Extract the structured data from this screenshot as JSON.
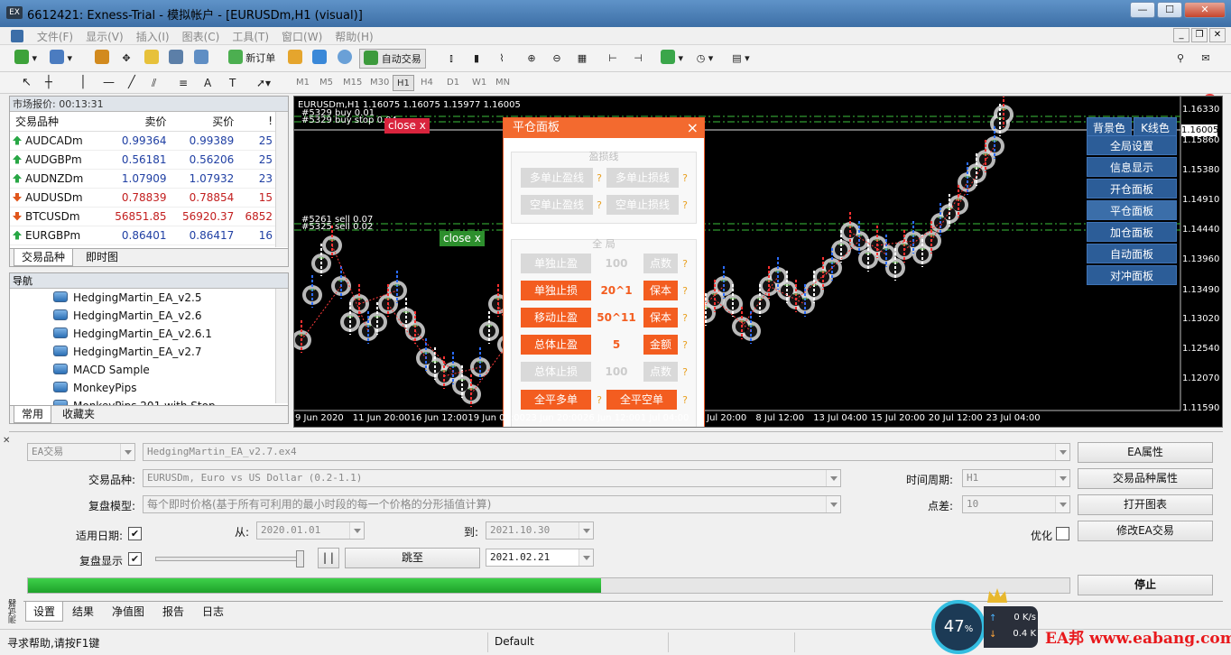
{
  "window": {
    "title": "6612421: Exness-Trial - 模拟帐户 - [EURUSDm,H1 (visual)]",
    "logo": "EX"
  },
  "menu": [
    "文件(F)",
    "显示(V)",
    "插入(I)",
    "图表(C)",
    "工具(T)",
    "窗口(W)",
    "帮助(H)"
  ],
  "toolbar": {
    "new_order": "新订单",
    "auto_trading": "自动交易",
    "badge_count": "1"
  },
  "timeframes": [
    "M1",
    "M5",
    "M15",
    "M30",
    "H1",
    "H4",
    "D1",
    "W1",
    "MN"
  ],
  "active_timeframe": "H1",
  "market_watch": {
    "title": "市场报价: 00:13:31",
    "columns": [
      "交易品种",
      "卖价",
      "买价",
      "!"
    ],
    "rows": [
      {
        "symbol": "AUDCADm",
        "bid": "0.99364",
        "ask": "0.99389",
        "spread": "25",
        "dir": "up"
      },
      {
        "symbol": "AUDGBPm",
        "bid": "0.56181",
        "ask": "0.56206",
        "spread": "25",
        "dir": "up"
      },
      {
        "symbol": "AUDNZDm",
        "bid": "1.07909",
        "ask": "1.07932",
        "spread": "23",
        "dir": "up"
      },
      {
        "symbol": "AUDUSDm",
        "bid": "0.78839",
        "ask": "0.78854",
        "spread": "15",
        "dir": "down"
      },
      {
        "symbol": "BTCUSDm",
        "bid": "56851.85",
        "ask": "56920.37",
        "spread": "6852",
        "dir": "down"
      },
      {
        "symbol": "EURGBPm",
        "bid": "0.86401",
        "ask": "0.86417",
        "spread": "16",
        "dir": "up"
      }
    ],
    "tabs": [
      "交易品种",
      "即时图"
    ]
  },
  "navigator": {
    "title": "导航",
    "items": [
      "HedgingMartin_EA_v2.5",
      "HedgingMartin_EA_v2.6",
      "HedgingMartin_EA_v2.6.1",
      "HedgingMartin_EA_v2.7",
      "MACD Sample",
      "MonkeyPips",
      "MonkeyPips 201 with Stop"
    ],
    "tabs": [
      "常用",
      "收藏夹"
    ]
  },
  "chart": {
    "header": "EURUSDm,H1  1.16075 1.16075 1.15977 1.16005",
    "orders": [
      "#5329 buy 0.01",
      "#5329 buy stop 0.04",
      "#5261 sell 0.07",
      "#5325 sell 0.02"
    ],
    "close_label": "close x",
    "price_labels": [
      "1.16330",
      "1.16005",
      "1.15860",
      "1.15380",
      "1.14910",
      "1.14440",
      "1.13960",
      "1.13490",
      "1.13020",
      "1.12540",
      "1.12070",
      "1.11590"
    ],
    "current_price": "1.16005",
    "time_labels": [
      "9 Jun 2020",
      "11 Jun 20:00",
      "16 Jun 12:00",
      "19 Jun 04:00",
      "23 Jun 20:00",
      "26 Jun 12:00",
      "1 Jul 04:00",
      "3 Jul 20:00",
      "8 Jul 12:00",
      "13 Jul 04:00",
      "15 Jul 20:00",
      "20 Jul 12:00",
      "23 Jul 04:00"
    ]
  },
  "close_panel": {
    "title": "平仓面板",
    "close_icon": "×",
    "group1_label": "盈损线",
    "multi_tp": "多单止盈线",
    "multi_sl": "多单止损线",
    "short_tp": "空单止盈线",
    "short_sl": "空单止损线",
    "group2_label": "全  局",
    "single_tp": "单独止盈",
    "single_tp_val": "100",
    "single_tp_unit": "点数",
    "single_sl": "单独止损",
    "single_sl_val": "20^1",
    "single_sl_unit": "保本",
    "trailing": "移动止盈",
    "trailing_val": "50^11",
    "trailing_unit": "保本",
    "total_tp": "总体止盈",
    "total_tp_val": "5",
    "total_tp_unit": "金额",
    "total_sl": "总体止损",
    "total_sl_val": "100",
    "total_sl_unit": "点数",
    "close_all_long": "全平多单",
    "close_all_short": "全平空单",
    "help": "?"
  },
  "right_panel": {
    "bg_color": "背景色",
    "k_line": "K线色",
    "buttons": [
      "全局设置",
      "信息显示",
      "开仓面板",
      "平仓面板",
      "加仓面板",
      "自动面板",
      "对冲面板"
    ]
  },
  "tester": {
    "mode": "EA交易",
    "ea_file": "HedgingMartin_EA_v2.7.ex4",
    "ea_props": "EA属性",
    "symbol_label": "交易品种:",
    "symbol_value": "EURUSDm, Euro vs US Dollar (0.2-1.1)",
    "period_label": "时间周期:",
    "period_value": "H1",
    "symbol_props": "交易品种属性",
    "model_label": "复盘模型:",
    "model_value": "每个即时价格(基于所有可利用的最小时段的每一个价格的分形插值计算)",
    "spread_label": "点差:",
    "spread_value": "10",
    "open_chart": "打开图表",
    "use_date_label": "适用日期:",
    "from_label": "从:",
    "from_value": "2020.01.01",
    "to_label": "到:",
    "to_value": "2021.10.30",
    "optimize_label": "优化",
    "modify_ea": "修改EA交易",
    "visual_label": "复盘显示",
    "pause_label": "| |",
    "skip_label": "跳至",
    "skip_date": "2021.02.21",
    "progress": 0.55,
    "stop_label": "停止",
    "tabs": [
      "设置",
      "结果",
      "净值图",
      "报告",
      "日志"
    ],
    "side_label": "测试器"
  },
  "status": {
    "help": "寻求帮助,请按F1键",
    "profile": "Default",
    "cpu": "47",
    "cpu_unit": "%",
    "net_up": "0 K/s",
    "net_down": "0.4 K",
    "watermark": "EA邦 www.eabang.com"
  }
}
